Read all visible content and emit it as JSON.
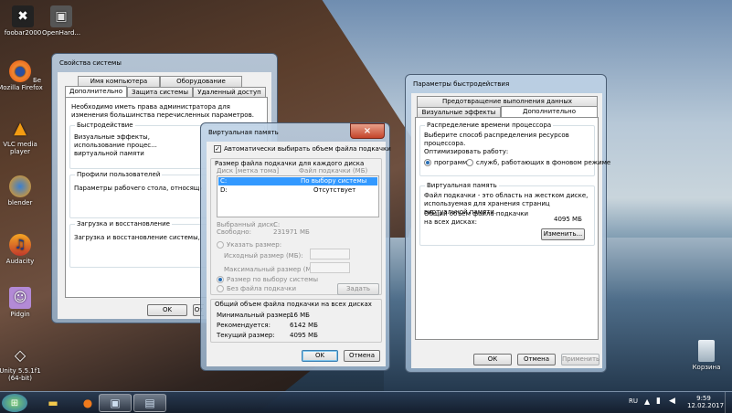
{
  "desktop": {
    "icons": [
      {
        "label": "foobar2000",
        "icon": "foobar-icon"
      },
      {
        "label": "OpenHard...",
        "icon": "monitor-icon"
      },
      {
        "label": "Mozilla Firefox",
        "icon": "firefox-icon"
      },
      {
        "label": "Бе",
        "icon": "shortcut-icon"
      },
      {
        "label": "VLC media player",
        "icon": "vlc-icon"
      },
      {
        "label": "blender",
        "icon": "blender-icon"
      },
      {
        "label": "Audacity",
        "icon": "audacity-icon"
      },
      {
        "label": "Pidgin",
        "icon": "pidgin-icon"
      },
      {
        "label": "Unity 5.5.1f1 (64-bit)",
        "icon": "unity-icon"
      },
      {
        "label": "Корзина",
        "icon": "recycle-bin-icon"
      }
    ]
  },
  "sysprops": {
    "title": "Свойства системы",
    "tabs": [
      "Имя компьютера",
      "Оборудование",
      "Дополнительно",
      "Защита системы",
      "Удаленный доступ"
    ],
    "admin_note": "Необходимо иметь права администратора для изменения большинства перечисленных параметров.",
    "perf_title": "Быстродействие",
    "perf_text": "Визуальные эффекты, использование процес... виртуальной памяти",
    "profiles_title": "Профили пользователей",
    "profiles_text": "Параметры рабочего стола, относящиеся ко в...",
    "boot_title": "Загрузка и восстановление",
    "boot_text": "Загрузка и восстановление системы, отладо...",
    "ok": "OK",
    "cancel": "От"
  },
  "vmem": {
    "title": "Виртуальная память",
    "auto_label": "Автоматически выбирать объем файла подкачки",
    "group_title": "Размер файла подкачки для каждого диска",
    "col_disk": "Диск [метка тома]",
    "col_file": "Файл подкачки (МБ)",
    "rows": [
      {
        "disk": "C:",
        "value": "По выбору системы"
      },
      {
        "disk": "D:",
        "value": "Отсутствует"
      }
    ],
    "selected_disk_label": "Выбранный диск:",
    "selected_disk": "C:",
    "free_label": "Свободно:",
    "free_value": "231971 МБ",
    "custom_label": "Указать размер:",
    "initial_label": "Исходный размер (МБ):",
    "max_label": "Максимальный размер (МБ):",
    "system_label": "Размер по выбору системы",
    "none_label": "Без файла подкачки",
    "set_btn": "Задать",
    "total_title": "Общий объем файла подкачки на всех дисках",
    "min_label": "Минимальный размер:",
    "min_value": "16 МБ",
    "rec_label": "Рекомендуется:",
    "rec_value": "6142 МБ",
    "cur_label": "Текущий размер:",
    "cur_value": "4095 МБ",
    "ok": "OK",
    "cancel": "Отмена"
  },
  "perf": {
    "title": "Параметры быстродействия",
    "tabs": [
      "Предотвращение выполнения данных",
      "Визуальные эффекты",
      "Дополнительно"
    ],
    "sched_title": "Распределение времени процессора",
    "sched_text": "Выберите способ распределения ресурсов процессора.",
    "optimize_label": "Оптимизировать работу:",
    "opt_programs": "программ",
    "opt_services": "служб, работающих в фоновом режиме",
    "vm_title": "Виртуальная память",
    "vm_text": "Файл подкачки - это область на жестком диске, используемая для хранения страниц виртуальной памяти.",
    "vm_total_label": "Общий объем файла подкачки на всех дисках:",
    "vm_total_value": "4095 МБ",
    "change_btn": "Изменить...",
    "ok": "ОК",
    "cancel": "Отмена",
    "apply": "Применить"
  },
  "taskbar": {
    "lang": "RU",
    "time": "9:59",
    "date": "12.02.2017"
  }
}
